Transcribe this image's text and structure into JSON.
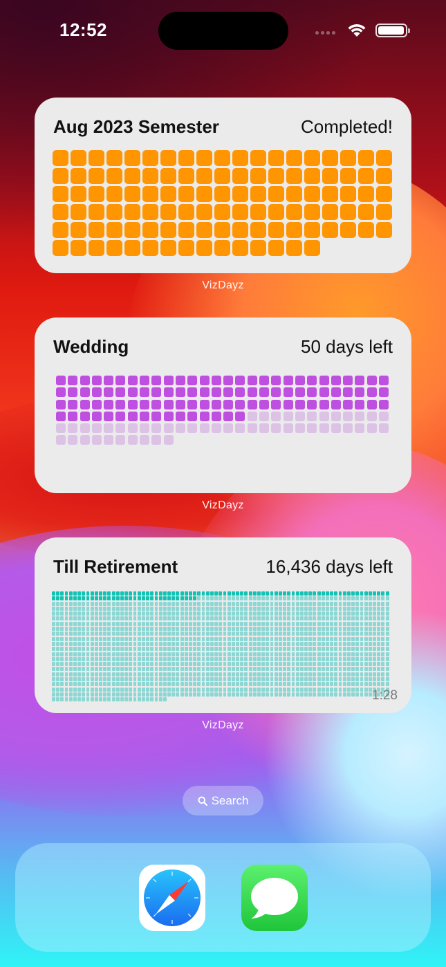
{
  "status_bar": {
    "time": "12:52"
  },
  "widgets": [
    {
      "title": "Aug 2023 Semester",
      "status": "Completed!",
      "app_label": "VizDayz",
      "accent_color": "#ff9500",
      "remaining_color": "#f7d7a8",
      "total_days": 110,
      "elapsed_days": 110
    },
    {
      "title": "Wedding",
      "status": "50 days left",
      "app_label": "VizDayz",
      "accent_color": "#bf4fe0",
      "remaining_color": "#dcc3e6",
      "total_days": 150,
      "elapsed_days": 100
    },
    {
      "title": "Till Retirement",
      "status": "16,436 days left",
      "app_label": "VizDayz",
      "accent_color": "#14c2b4",
      "remaining_color": "#8ad7d4",
      "total_days": 1686,
      "elapsed_days": 113,
      "time": "1:28"
    }
  ],
  "search": {
    "label": "Search"
  },
  "dock": {
    "apps": [
      "Safari",
      "Messages"
    ]
  }
}
